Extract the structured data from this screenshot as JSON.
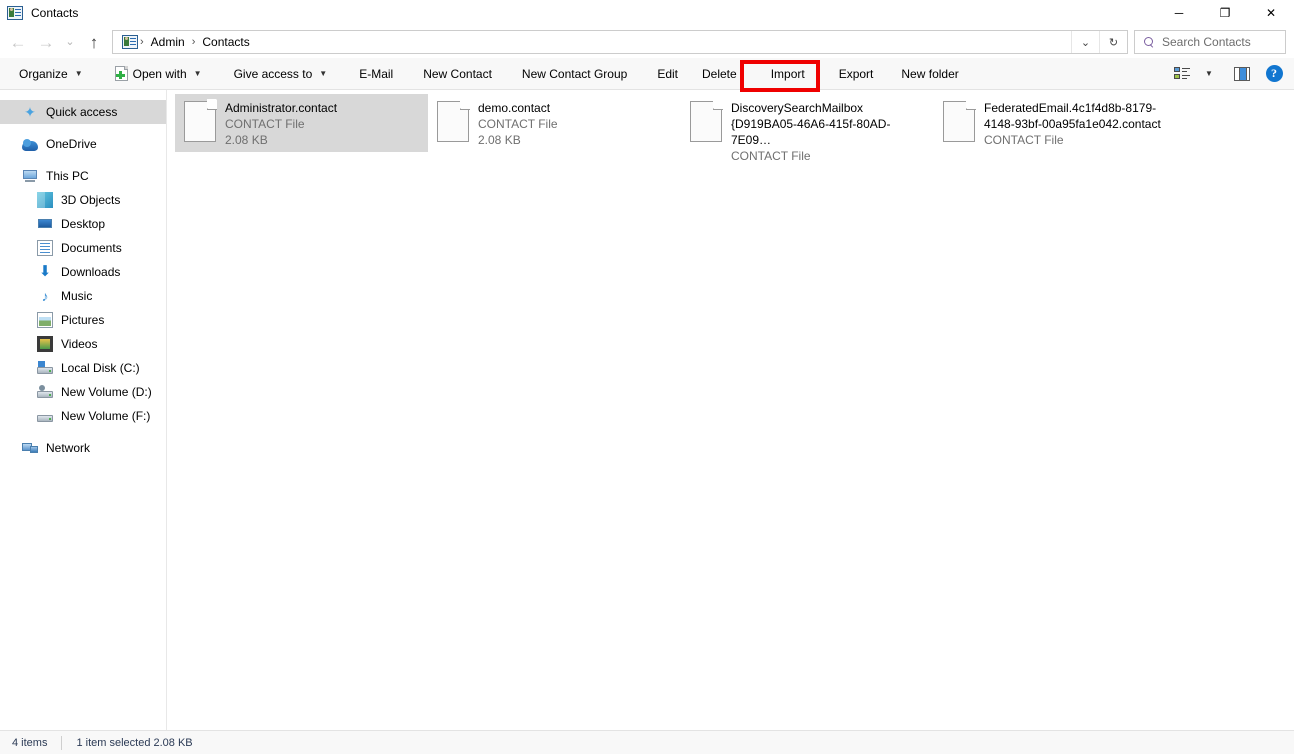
{
  "window": {
    "title": "Contacts",
    "title_icon": "contacts-icon",
    "controls": {
      "minimize": "─",
      "maximize": "❐",
      "close": "✕"
    }
  },
  "navbar": {
    "back": "←",
    "forward": "→",
    "recent": "⌄",
    "up": "↑",
    "breadcrumbs": [
      {
        "label": "Admin"
      },
      {
        "label": "Contacts"
      }
    ],
    "separator": "›",
    "dropdown": "⌄",
    "refresh": "↻"
  },
  "search": {
    "placeholder": "Search Contacts",
    "icon": "search-icon"
  },
  "toolbar": {
    "items": [
      {
        "label": "Organize",
        "caret": true,
        "icon": null
      },
      {
        "label": "Open with",
        "caret": true,
        "icon": "open-with-icon"
      },
      {
        "label": "Give access to",
        "caret": true,
        "icon": null
      },
      {
        "label": "E-Mail",
        "caret": false,
        "icon": null
      },
      {
        "label": "New Contact",
        "caret": false,
        "icon": null
      },
      {
        "label": "New Contact Group",
        "caret": false,
        "icon": null
      },
      {
        "label": "Edit",
        "caret": false,
        "icon": null
      },
      {
        "label": "Delete",
        "caret": false,
        "icon": null
      },
      {
        "label": "Import",
        "caret": false,
        "icon": null,
        "highlighted": true
      },
      {
        "label": "Export",
        "caret": false,
        "icon": null
      },
      {
        "label": "New folder",
        "caret": false,
        "icon": null
      }
    ],
    "view_options_caret": "▼",
    "highlight_color": "#ef0000",
    "help_label": "?"
  },
  "sidebar": {
    "items": [
      {
        "label": "Quick access",
        "icon": "star-icon",
        "indent": false,
        "selected": true
      },
      {
        "label": "OneDrive",
        "icon": "cloud-icon",
        "indent": false,
        "selected": false,
        "gap_before": true
      },
      {
        "label": "This PC",
        "icon": "monitor-icon",
        "indent": false,
        "selected": false,
        "gap_before": true
      },
      {
        "label": "3D Objects",
        "icon": "cube-icon",
        "indent": true,
        "selected": false
      },
      {
        "label": "Desktop",
        "icon": "desktop-icon",
        "indent": true,
        "selected": false
      },
      {
        "label": "Documents",
        "icon": "documents-icon",
        "indent": true,
        "selected": false
      },
      {
        "label": "Downloads",
        "icon": "download-arrow-icon",
        "indent": true,
        "selected": false
      },
      {
        "label": "Music",
        "icon": "music-note-icon",
        "indent": true,
        "selected": false
      },
      {
        "label": "Pictures",
        "icon": "picture-icon",
        "indent": true,
        "selected": false
      },
      {
        "label": "Videos",
        "icon": "video-icon",
        "indent": true,
        "selected": false
      },
      {
        "label": "Local Disk (C:)",
        "icon": "hard-drive-icon",
        "indent": true,
        "selected": false
      },
      {
        "label": "New Volume (D:)",
        "icon": "disk-drive-icon",
        "indent": true,
        "selected": false
      },
      {
        "label": "New Volume (F:)",
        "icon": "disk-drive-plain-icon",
        "indent": true,
        "selected": false
      },
      {
        "label": "Network",
        "icon": "network-icon",
        "indent": false,
        "selected": false,
        "gap_before": true
      }
    ]
  },
  "files": [
    {
      "name": "Administrator.contact",
      "type": "CONTACT File",
      "size": "2.08 KB",
      "selected": true
    },
    {
      "name": "demo.contact",
      "type": "CONTACT File",
      "size": "2.08 KB",
      "selected": false
    },
    {
      "name": "DiscoverySearchMailbox {D919BA05-46A6-415f-80AD-7E09…",
      "type": "CONTACT File",
      "size": "",
      "selected": false
    },
    {
      "name": "FederatedEmail.4c1f4d8b-8179-4148-93bf-00a95fa1e042.contact",
      "type": "CONTACT File",
      "size": "",
      "selected": false
    }
  ],
  "statusbar": {
    "item_count": "4 items",
    "selection": "1 item selected  2.08 KB"
  }
}
